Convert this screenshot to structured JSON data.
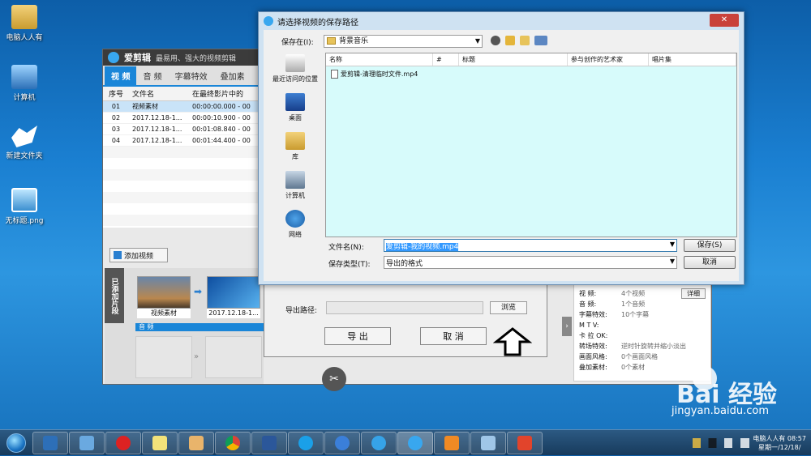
{
  "desktop": {
    "icons": [
      {
        "label": "电脑人人有",
        "icon": "user-folder-icon"
      },
      {
        "label": "计算机",
        "icon": "computer-icon"
      },
      {
        "label": "新建文件夹",
        "icon": "folder-icon"
      },
      {
        "label": "无标题.png",
        "icon": "image-file-icon"
      }
    ]
  },
  "app": {
    "name": "爱剪辑",
    "slogan": "最易用、强大的视频剪辑",
    "tabs": [
      "视 频",
      "音 频",
      "字幕特效",
      "叠加素"
    ],
    "table": {
      "headers": [
        "序号",
        "文件名",
        "在最终影片中的"
      ],
      "rows": [
        {
          "num": "01",
          "name": "视频素材",
          "time": "00:00:00.000 - 00"
        },
        {
          "num": "02",
          "name": "2017.12.18-1...",
          "time": "00:00:10.900 - 00"
        },
        {
          "num": "03",
          "name": "2017.12.18-1...",
          "time": "00:01:08.840 - 00"
        },
        {
          "num": "04",
          "name": "2017.12.18-1...",
          "time": "00:01:44.400 - 00"
        }
      ]
    },
    "add_video": "添加视频",
    "added_segments": "已添加片段",
    "clips": [
      "视频素材",
      "2017.12.18-1..."
    ],
    "audio_label": "音 频",
    "export": {
      "path_label": "导出路径:",
      "browse": "浏览",
      "export_btn": "导 出",
      "cancel_btn": "取 消"
    },
    "info": {
      "rows": [
        {
          "k": "视  频:",
          "v": "4个视频"
        },
        {
          "k": "音  频:",
          "v": "1个音频"
        },
        {
          "k": "字幕特效:",
          "v": "10个字幕"
        },
        {
          "k": "M  T  V:",
          "v": ""
        },
        {
          "k": "卡 拉 OK:",
          "v": ""
        },
        {
          "k": "转场特效:",
          "v": "逆时针旋转并缩小淡出"
        },
        {
          "k": "画面风格:",
          "v": "0个画面风格"
        },
        {
          "k": "叠加素材:",
          "v": "0个素材"
        }
      ],
      "detail": "详细"
    }
  },
  "dialog": {
    "title": "请选择视频的保存路径",
    "close": "✕",
    "save_in_label": "保存在(I):",
    "save_in_value": "背景音乐",
    "places": [
      {
        "label": "最近访问的位置",
        "icon": "recent-places-icon"
      },
      {
        "label": "桌面",
        "icon": "desktop-icon"
      },
      {
        "label": "库",
        "icon": "library-icon"
      },
      {
        "label": "计算机",
        "icon": "computer-icon"
      },
      {
        "label": "网络",
        "icon": "network-icon"
      }
    ],
    "columns": [
      "名称",
      "#",
      "标题",
      "参与创作的艺术家",
      "唱片集"
    ],
    "files": [
      "爱剪辑-清理临时文件.mp4"
    ],
    "filename_label": "文件名(N):",
    "filename_value": "爱剪辑-我的视频.mp4",
    "filetype_label": "保存类型(T):",
    "filetype_value": "导出的格式",
    "save_btn": "保存(S)",
    "cancel_btn": "取消"
  },
  "taskbar": {
    "buttons": [
      "show-desktop-icon",
      "remote-desktop-icon",
      "chess-app-icon",
      "notes-icon",
      "paint-icon",
      "chrome-icon",
      "word-icon",
      "browser-icon",
      "sogou-icon",
      "ie-icon",
      "aijianji-icon",
      "media-player-icon",
      "explorer-icon",
      "sogou-input-icon"
    ],
    "clock_user": "电脑人人有 08:57",
    "clock_date": "星期一/12/18/"
  },
  "watermark": {
    "main": "Bai 经验",
    "sub": "jingyan.baidu.com"
  },
  "colors": {
    "accent": "#1a86d8",
    "selection": "#3399ff",
    "list_bg": "#d7fbfb"
  }
}
